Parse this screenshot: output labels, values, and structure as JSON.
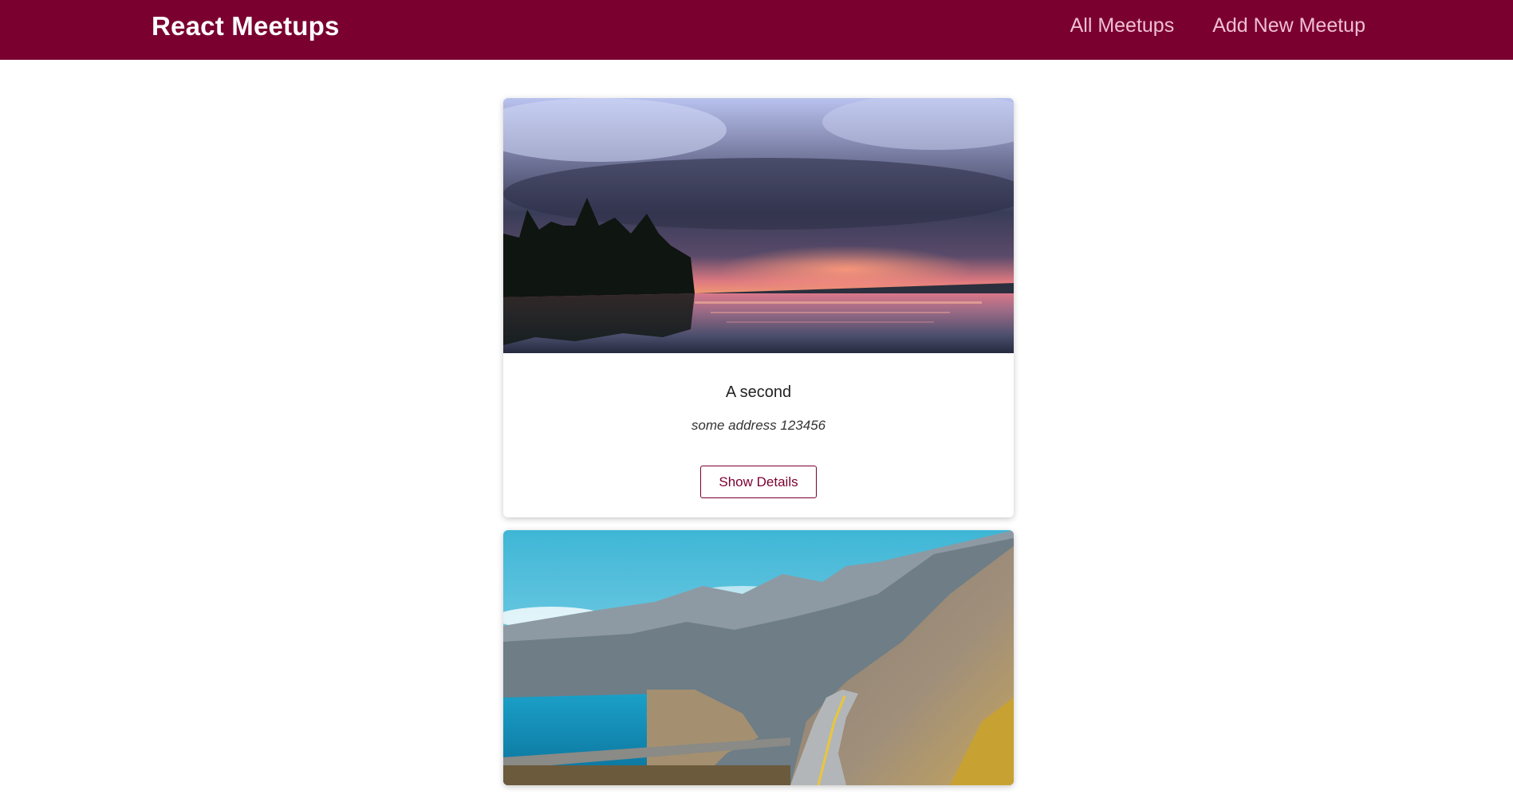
{
  "header": {
    "logo": "React Meetups",
    "nav": [
      {
        "label": "All Meetups"
      },
      {
        "label": "Add New Meetup"
      }
    ]
  },
  "meetups": [
    {
      "title": "A second",
      "address": "some address 123456",
      "button_label": "Show Details",
      "image": "stormy lake at sunset with pine trees"
    },
    {
      "title": "",
      "address": "",
      "button_label": "",
      "image": "coastal mountain road by the sea"
    }
  ],
  "colors": {
    "header_bg": "#7a0030",
    "nav_link": "#f1bfd3",
    "accent": "#7a0030"
  }
}
